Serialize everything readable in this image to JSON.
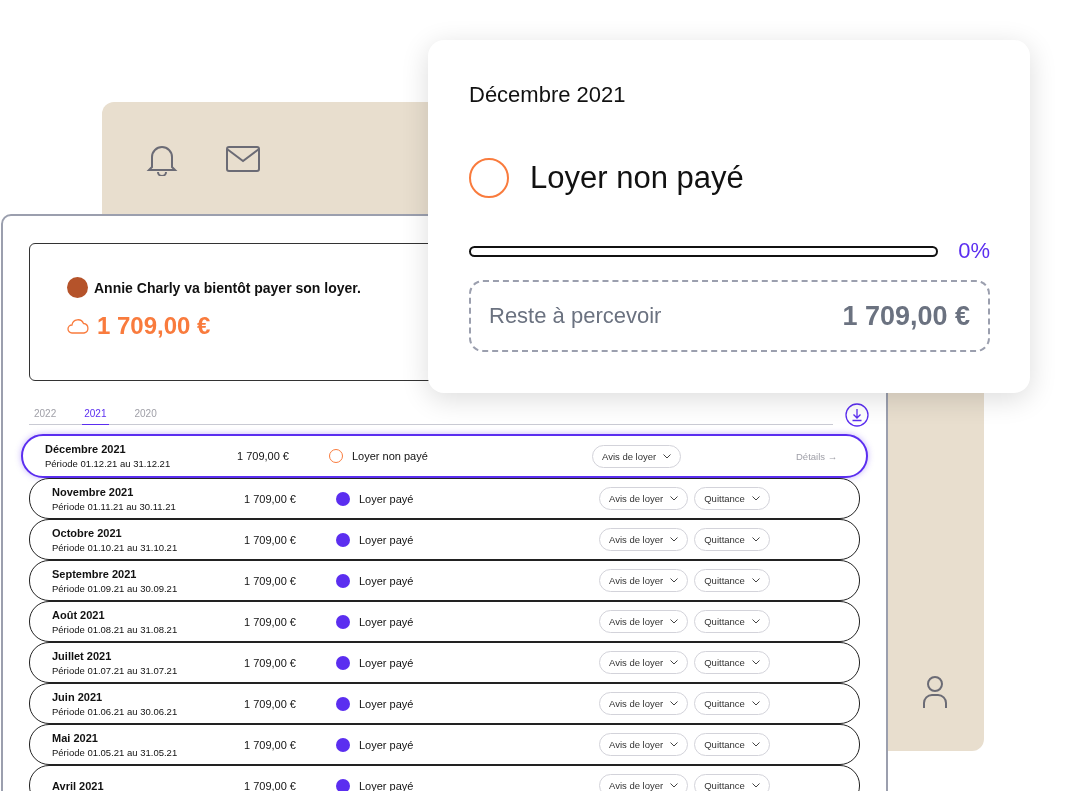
{
  "summary": {
    "message": "Annie Charly va bientôt payer son loyer.",
    "amount": "1 709,00 €"
  },
  "tabs": [
    {
      "label": "2022",
      "selected": false
    },
    {
      "label": "2021",
      "selected": true
    },
    {
      "label": "2020",
      "selected": false
    }
  ],
  "rows": [
    {
      "title": "Décembre 2021",
      "period": "Période 01.12.21 au 31.12.21",
      "amount": "1 709,00 €",
      "paid": false,
      "status": "Loyer non payé",
      "selected": true,
      "buttons": [
        "Avis de loyer"
      ],
      "details": "Détails →"
    },
    {
      "title": "Novembre 2021",
      "period": "Période 01.11.21 au 30.11.21",
      "amount": "1 709,00 €",
      "paid": true,
      "status": "Loyer payé",
      "selected": false,
      "buttons": [
        "Avis de loyer",
        "Quittance"
      ]
    },
    {
      "title": "Octobre 2021",
      "period": "Période 01.10.21 au 31.10.21",
      "amount": "1 709,00 €",
      "paid": true,
      "status": "Loyer payé",
      "selected": false,
      "buttons": [
        "Avis de loyer",
        "Quittance"
      ]
    },
    {
      "title": "Septembre 2021",
      "period": "Période 01.09.21 au 30.09.21",
      "amount": "1 709,00 €",
      "paid": true,
      "status": "Loyer payé",
      "selected": false,
      "buttons": [
        "Avis de loyer",
        "Quittance"
      ]
    },
    {
      "title": "Août 2021",
      "period": "Période 01.08.21 au 31.08.21",
      "amount": "1 709,00 €",
      "paid": true,
      "status": "Loyer payé",
      "selected": false,
      "buttons": [
        "Avis de loyer",
        "Quittance"
      ]
    },
    {
      "title": "Juillet 2021",
      "period": "Période 01.07.21 au 31.07.21",
      "amount": "1 709,00 €",
      "paid": true,
      "status": "Loyer payé",
      "selected": false,
      "buttons": [
        "Avis de loyer",
        "Quittance"
      ]
    },
    {
      "title": "Juin 2021",
      "period": "Période 01.06.21 au 30.06.21",
      "amount": "1 709,00 €",
      "paid": true,
      "status": "Loyer payé",
      "selected": false,
      "buttons": [
        "Avis de loyer",
        "Quittance"
      ]
    },
    {
      "title": "Mai 2021",
      "period": "Période 01.05.21 au 31.05.21",
      "amount": "1 709,00 €",
      "paid": true,
      "status": "Loyer payé",
      "selected": false,
      "buttons": [
        "Avis de loyer",
        "Quittance"
      ]
    },
    {
      "title": "Avril 2021",
      "amount": "1 709,00 €",
      "paid": true,
      "status": "Loyer payé",
      "selected": false,
      "buttons": [
        "Avis de loyer",
        "Quittance"
      ]
    }
  ],
  "popup": {
    "title": "Décembre 2021",
    "paid": false,
    "status": "Loyer non payé",
    "level": 0,
    "percent": "0%",
    "remaining_label": "Reste à percevoir",
    "remaining_amount": "1 709,00 €"
  }
}
